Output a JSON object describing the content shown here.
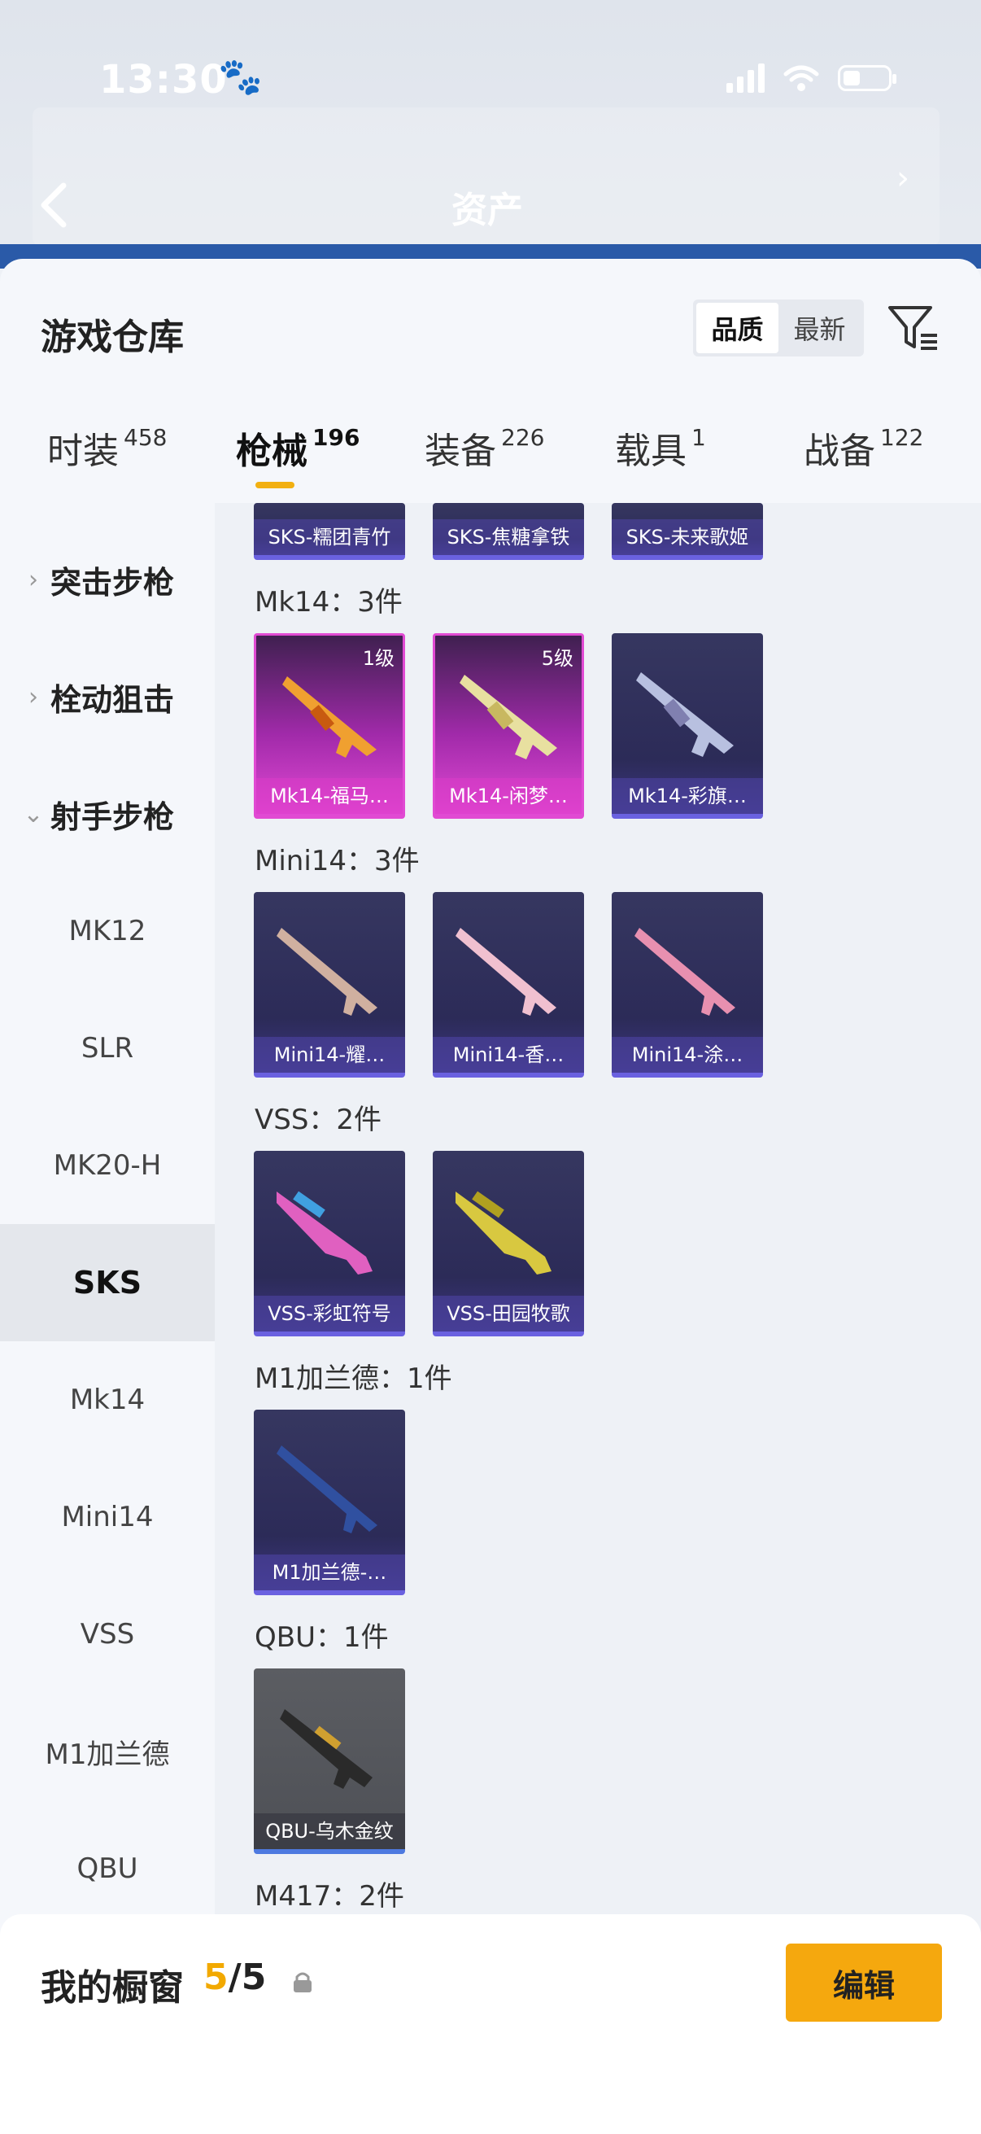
{
  "status_bar": {
    "time": "13:30"
  },
  "header": {
    "title": "资产"
  },
  "warehouse": {
    "title": "游戏仓库"
  },
  "sort_toggle": {
    "quality": "品质",
    "latest": "最新"
  },
  "tabs": [
    {
      "label": "时装",
      "count": "458"
    },
    {
      "label": "枪械",
      "count": "196"
    },
    {
      "label": "装备",
      "count": "226"
    },
    {
      "label": "载具",
      "count": "1"
    },
    {
      "label": "战备",
      "count": "122"
    }
  ],
  "categories": [
    {
      "label": "突击步枪",
      "expanded": false
    },
    {
      "label": "栓动狙击",
      "expanded": false
    },
    {
      "label": "射手步枪",
      "expanded": true
    }
  ],
  "subcategories": [
    "MK12",
    "SLR",
    "MK20-H",
    "SKS",
    "Mk14",
    "Mini14",
    "VSS",
    "M1加兰德",
    "QBU"
  ],
  "selected_subcategory": "SKS",
  "groups": [
    {
      "label": "",
      "items": [
        "SKS-糯团青竹",
        "SKS-焦糖拿铁",
        "SKS-未来歌姬"
      ]
    },
    {
      "label": "Mk14：3件",
      "items": [
        "Mk14-福马…",
        "Mk14-闲梦…",
        "Mk14-彩旗…"
      ],
      "levels": [
        "1级",
        "5级",
        ""
      ]
    },
    {
      "label": "Mini14：3件",
      "items": [
        "Mini14-耀…",
        "Mini14-香…",
        "Mini14-涂…"
      ]
    },
    {
      "label": "VSS：2件",
      "items": [
        "VSS-彩虹符号",
        "VSS-田园牧歌"
      ]
    },
    {
      "label": "M1加兰德：1件",
      "items": [
        "M1加兰德-…"
      ]
    },
    {
      "label": "QBU：1件",
      "items": [
        "QBU-乌木金纹"
      ]
    },
    {
      "label": "M417：2件",
      "items": []
    }
  ],
  "my_window": {
    "title": "我的橱窗",
    "current": "5",
    "total": "/5",
    "edit": "编辑"
  },
  "colors": {
    "accent": "#f5a80e",
    "purple_rarity": "#6a61e0",
    "pink_rarity": "#e14ad3"
  }
}
